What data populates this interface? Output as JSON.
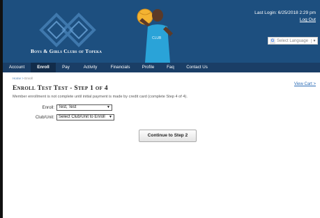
{
  "header": {
    "org_name": "Boys & Girls Clubs of Topeka",
    "last_login": "Last Login: 6/25/2018 2:29 pm",
    "logout": "Log Out",
    "language_select": "Select Language"
  },
  "nav": {
    "items": [
      {
        "label": "Account"
      },
      {
        "label": "Enroll"
      },
      {
        "label": "Pay"
      },
      {
        "label": "Activity"
      },
      {
        "label": "Financials"
      },
      {
        "label": "Profile"
      },
      {
        "label": "Faq"
      },
      {
        "label": "Contact Us"
      }
    ],
    "active": "Enroll"
  },
  "breadcrumb": {
    "home": "Home",
    "sep": " > ",
    "current": "Enroll"
  },
  "cart": {
    "label": "View Cart >"
  },
  "page": {
    "title": "Enroll Test Test - Step 1 of 4",
    "note": "Member enrollment is not complete until initial payment is made by credit card (complete Step 4 of 4)."
  },
  "form": {
    "enroll_label": "Enroll:",
    "enroll_value": "Test, Test",
    "club_label": "Club/Unit:",
    "club_value": "Select Club/Unit to Enroll"
  },
  "actions": {
    "continue": "Continue to Step 2"
  },
  "colors": {
    "banner": "#1d4f7f",
    "nav": "#1a3e66",
    "link": "#2a6bb5"
  }
}
